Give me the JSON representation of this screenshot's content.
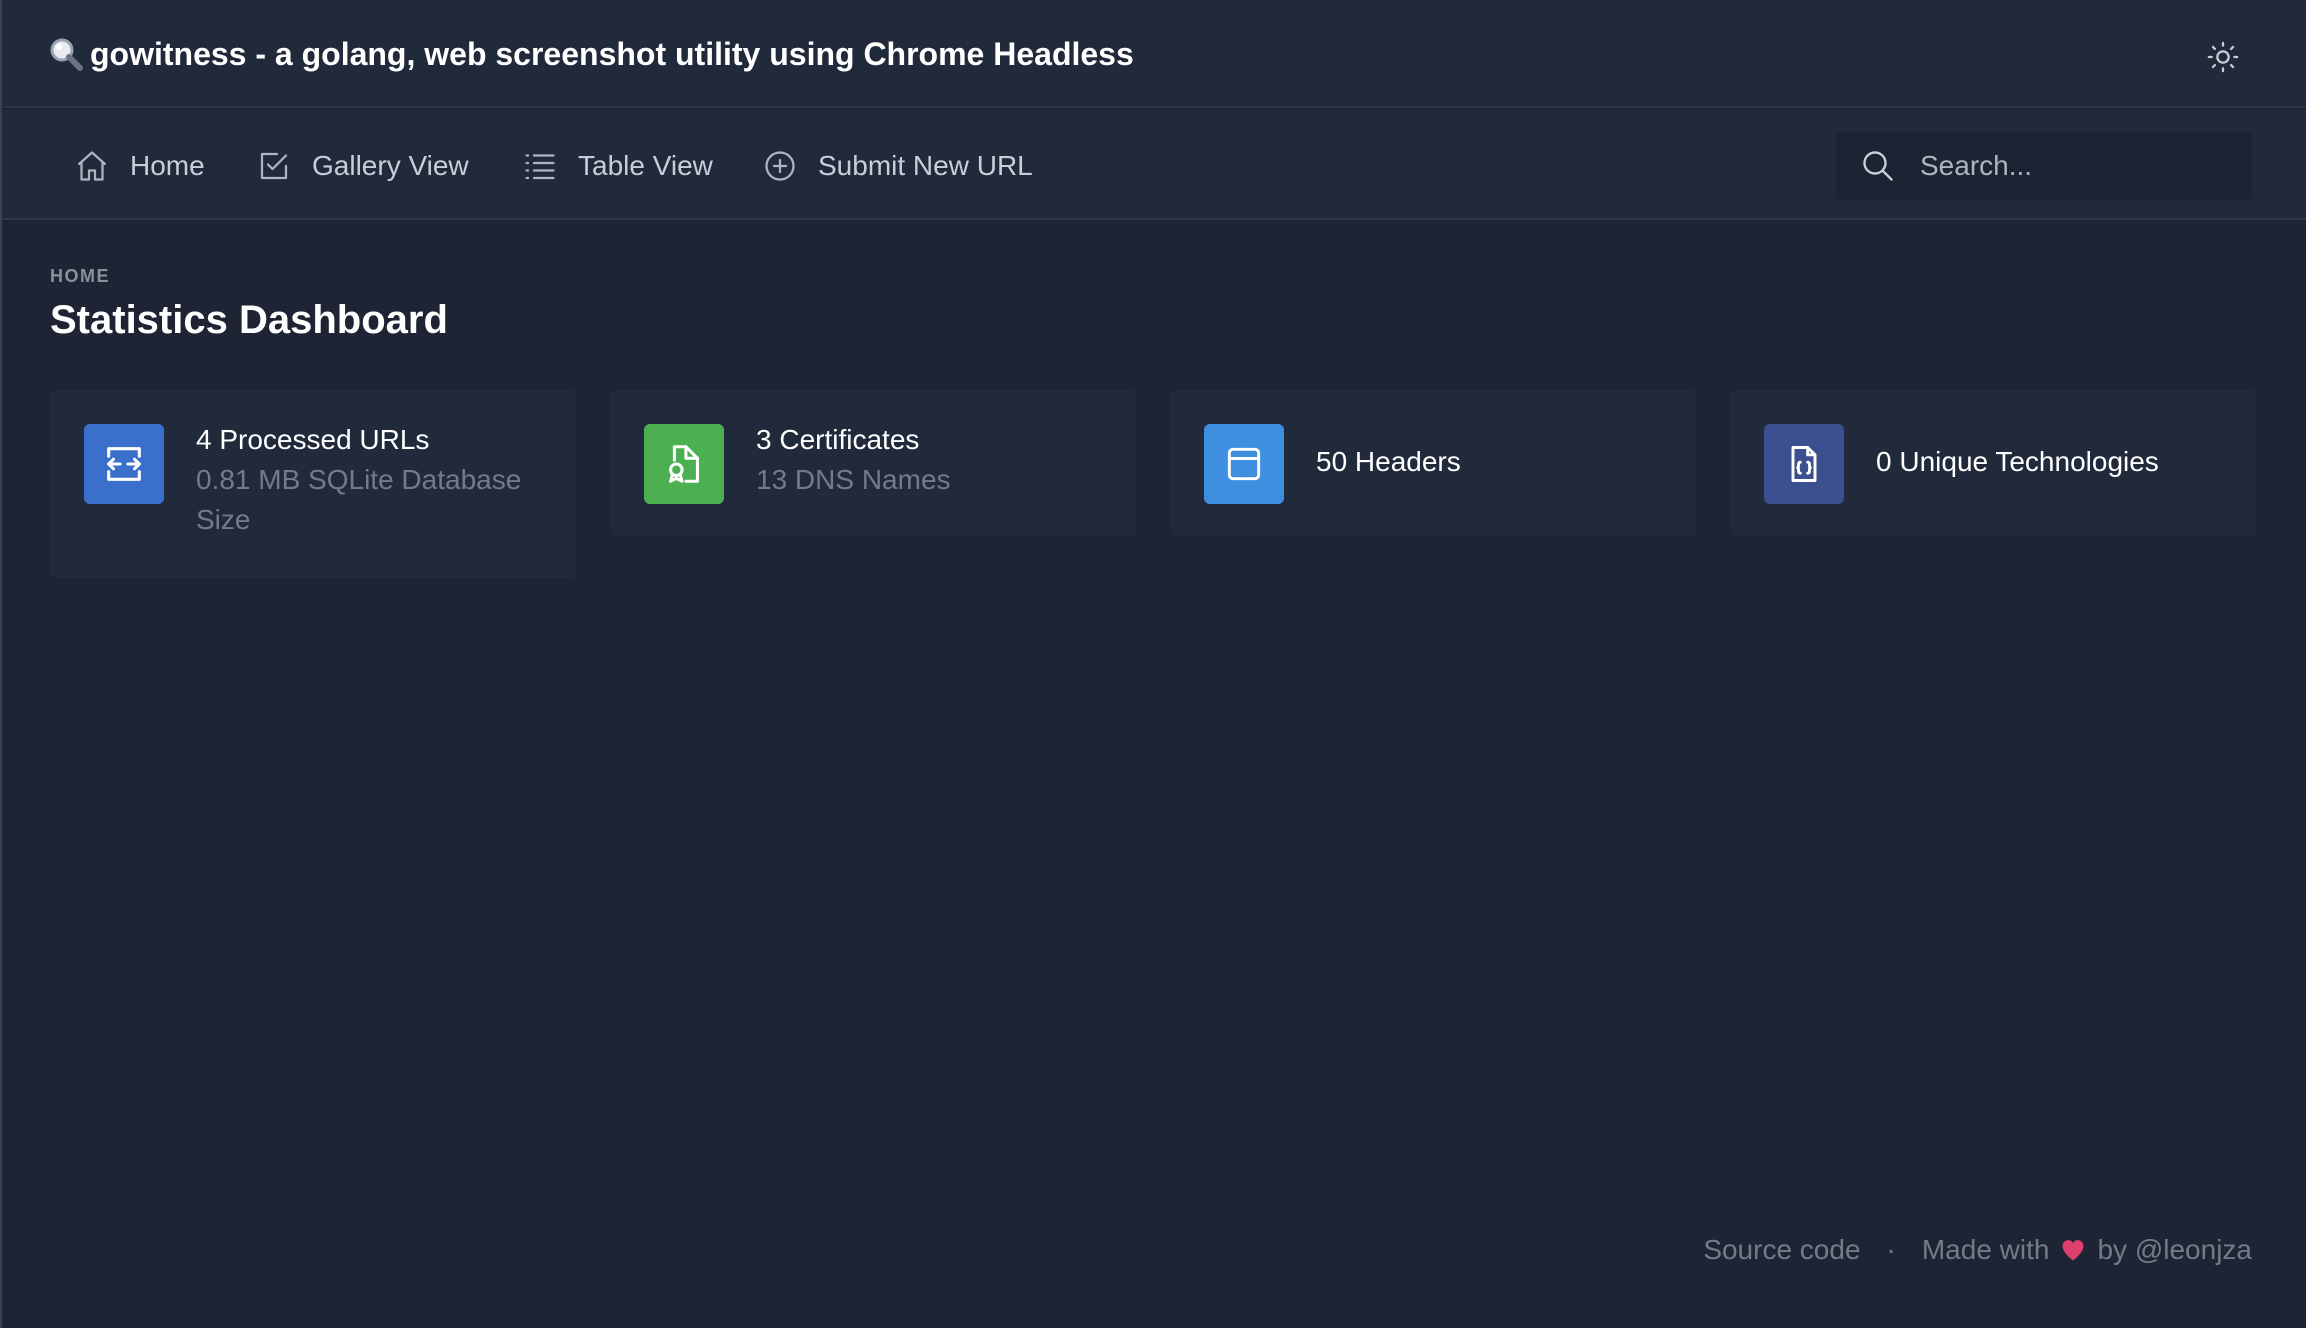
{
  "header": {
    "title": "gowitness - a golang, web screenshot utility using Chrome Headless",
    "theme_toggle_icon": "sun-icon"
  },
  "nav": {
    "items": [
      {
        "label": "Home",
        "icon": "home-icon"
      },
      {
        "label": "Gallery View",
        "icon": "checkbox-icon"
      },
      {
        "label": "Table View",
        "icon": "list-icon"
      },
      {
        "label": "Submit New URL",
        "icon": "plus-circle-icon"
      }
    ],
    "search_placeholder": "Search..."
  },
  "main": {
    "breadcrumb": "HOME",
    "title": "Statistics Dashboard",
    "cards": [
      {
        "primary": "4 Processed URLs",
        "secondary": "0.81 MB SQLite Database Size",
        "icon": "arrows-horizontal-icon",
        "color": "#3a6fcc"
      },
      {
        "primary": "3 Certificates",
        "secondary": "13 DNS Names",
        "icon": "certificate-file-icon",
        "color": "#4caf50"
      },
      {
        "primary": "50 Headers",
        "secondary": "",
        "icon": "browser-window-icon",
        "color": "#3f8fe0"
      },
      {
        "primary": "0 Unique Technologies",
        "secondary": "",
        "icon": "code-file-icon",
        "color": "#3c4f8f"
      }
    ]
  },
  "footer": {
    "source_label": "Source code",
    "separator": "·",
    "made_with": "Made with",
    "by": "by @leonjza",
    "heart_color": "#e0406e"
  }
}
